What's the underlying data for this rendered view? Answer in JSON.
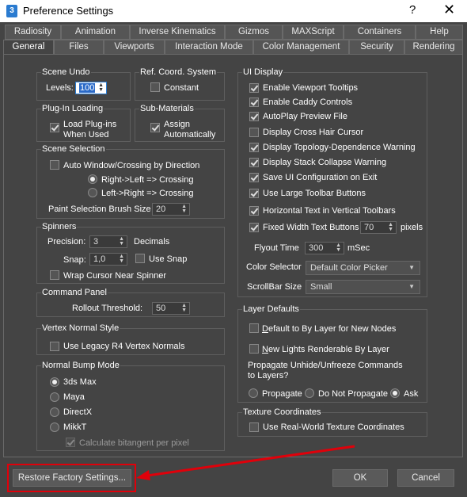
{
  "window": {
    "title": "Preference Settings",
    "logo_text": "3",
    "help_glyph": "?",
    "close_glyph": "✕"
  },
  "tabs_row1": [
    {
      "label": "Radiosity"
    },
    {
      "label": "Animation"
    },
    {
      "label": "Inverse Kinematics"
    },
    {
      "label": "Gizmos"
    },
    {
      "label": "MAXScript"
    },
    {
      "label": "Containers"
    },
    {
      "label": "Help"
    }
  ],
  "tabs_row2": [
    {
      "label": "General",
      "active": true
    },
    {
      "label": "Files"
    },
    {
      "label": "Viewports"
    },
    {
      "label": "Interaction Mode"
    },
    {
      "label": "Color Management"
    },
    {
      "label": "Security"
    },
    {
      "label": "Rendering"
    }
  ],
  "scene_undo": {
    "title": "Scene Undo",
    "levels_label": "Levels:",
    "levels_value": "100"
  },
  "ref_coord": {
    "title": "Ref. Coord. System",
    "constant_label": "Constant",
    "constant_checked": false
  },
  "plugin_loading": {
    "title": "Plug-In Loading",
    "load_label_1": "Load Plug-ins",
    "load_label_2": "When Used",
    "load_checked": true
  },
  "sub_materials": {
    "title": "Sub-Materials",
    "assign_label_1": "Assign",
    "assign_label_2": "Automatically",
    "assign_checked": true
  },
  "scene_selection": {
    "title": "Scene Selection",
    "auto_window_label": "Auto Window/Crossing by Direction",
    "auto_window_checked": false,
    "right_left_label": "Right->Left => Crossing",
    "right_left_selected": true,
    "left_right_label": "Left->Right => Crossing",
    "left_right_selected": false,
    "brush_size_label": "Paint Selection Brush Size",
    "brush_size_value": "20"
  },
  "spinners": {
    "title": "Spinners",
    "precision_label": "Precision:",
    "precision_value": "3",
    "decimals_label": "Decimals",
    "snap_label": "Snap:",
    "snap_value": "1,0",
    "use_snap_label": "Use Snap",
    "use_snap_checked": false,
    "wrap_label": "Wrap Cursor Near Spinner",
    "wrap_checked": false
  },
  "command_panel": {
    "title": "Command Panel",
    "rollout_label": "Rollout Threshold:",
    "rollout_value": "50"
  },
  "vertex_normal": {
    "title": "Vertex Normal Style",
    "legacy_label": "Use Legacy R4 Vertex Normals",
    "legacy_checked": false
  },
  "normal_bump": {
    "title": "Normal Bump Mode",
    "options": [
      {
        "label": "3ds Max",
        "selected": true
      },
      {
        "label": "Maya",
        "selected": false
      },
      {
        "label": "DirectX",
        "selected": false
      },
      {
        "label": "MikkT",
        "selected": false
      }
    ],
    "calc_label": "Calculate bitangent per pixel",
    "calc_checked": true
  },
  "ui_display": {
    "title": "UI Display",
    "checks": [
      {
        "label": "Enable Viewport Tooltips",
        "checked": true
      },
      {
        "label": "Enable Caddy Controls",
        "checked": true
      },
      {
        "label": "AutoPlay Preview File",
        "checked": true
      },
      {
        "label": "Display Cross Hair Cursor",
        "checked": false
      },
      {
        "label": "Display Topology-Dependence Warning",
        "checked": true
      },
      {
        "label": "Display Stack Collapse Warning",
        "checked": true
      },
      {
        "label": "Save UI Configuration on Exit",
        "checked": true
      },
      {
        "label": "Use Large Toolbar Buttons",
        "checked": true
      },
      {
        "label": "Horizontal Text in Vertical Toolbars",
        "checked": true
      }
    ],
    "fixed_width_label": "Fixed Width Text Buttons",
    "fixed_width_checked": true,
    "fixed_width_value": "70",
    "pixels_label": "pixels",
    "flyout_label": "Flyout Time",
    "flyout_value": "300",
    "msec_label": "mSec",
    "color_selector_label": "Color Selector",
    "color_selector_value": "Default Color Picker",
    "scrollbar_label": "ScrollBar Size",
    "scrollbar_value": "Small"
  },
  "layer_defaults": {
    "title": "Layer Defaults",
    "default_bylayer_prefix": "D",
    "default_bylayer_rest": "efault to By Layer for New Nodes",
    "default_bylayer_checked": false,
    "new_lights_prefix": "N",
    "new_lights_rest": "ew Lights Renderable By Layer",
    "new_lights_checked": false,
    "propagate_question_1": "Propagate Unhide/Unfreeze Commands",
    "propagate_question_2": "to Layers?",
    "options": [
      {
        "label": "Propagate",
        "selected": false
      },
      {
        "label": "Do Not Propagate",
        "selected": false
      },
      {
        "label": "Ask",
        "selected": true
      }
    ]
  },
  "texture_coords": {
    "title": "Texture Coordinates",
    "real_world_label": "Use Real-World Texture Coordinates",
    "real_world_checked": false
  },
  "buttons": {
    "restore": "Restore Factory Settings...",
    "ok": "OK",
    "cancel": "Cancel"
  },
  "annotation": {
    "highlight_color": "#e0000a"
  }
}
